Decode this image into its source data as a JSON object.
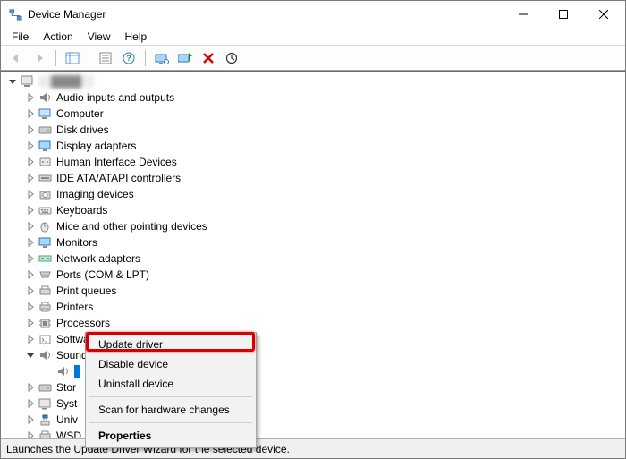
{
  "window": {
    "title": "Device Manager"
  },
  "menu": {
    "file": "File",
    "action": "Action",
    "view": "View",
    "help": "Help"
  },
  "tree": {
    "root": "████",
    "items": [
      "Audio inputs and outputs",
      "Computer",
      "Disk drives",
      "Display adapters",
      "Human Interface Devices",
      "IDE ATA/ATAPI controllers",
      "Imaging devices",
      "Keyboards",
      "Mice and other pointing devices",
      "Monitors",
      "Network adapters",
      "Ports (COM & LPT)",
      "Print queues",
      "Printers",
      "Processors",
      "Software devices",
      "Sound, video and game controllers"
    ],
    "trailing": {
      "stor": "Stor",
      "syst": "Syst",
      "univ": "Univ",
      "wsd": "WSD"
    }
  },
  "context_menu": {
    "update_driver": "Update driver",
    "disable_device": "Disable device",
    "uninstall_device": "Uninstall device",
    "scan_hw": "Scan for hardware changes",
    "properties": "Properties"
  },
  "statusbar": {
    "text": "Launches the Update Driver Wizard for the selected device."
  }
}
